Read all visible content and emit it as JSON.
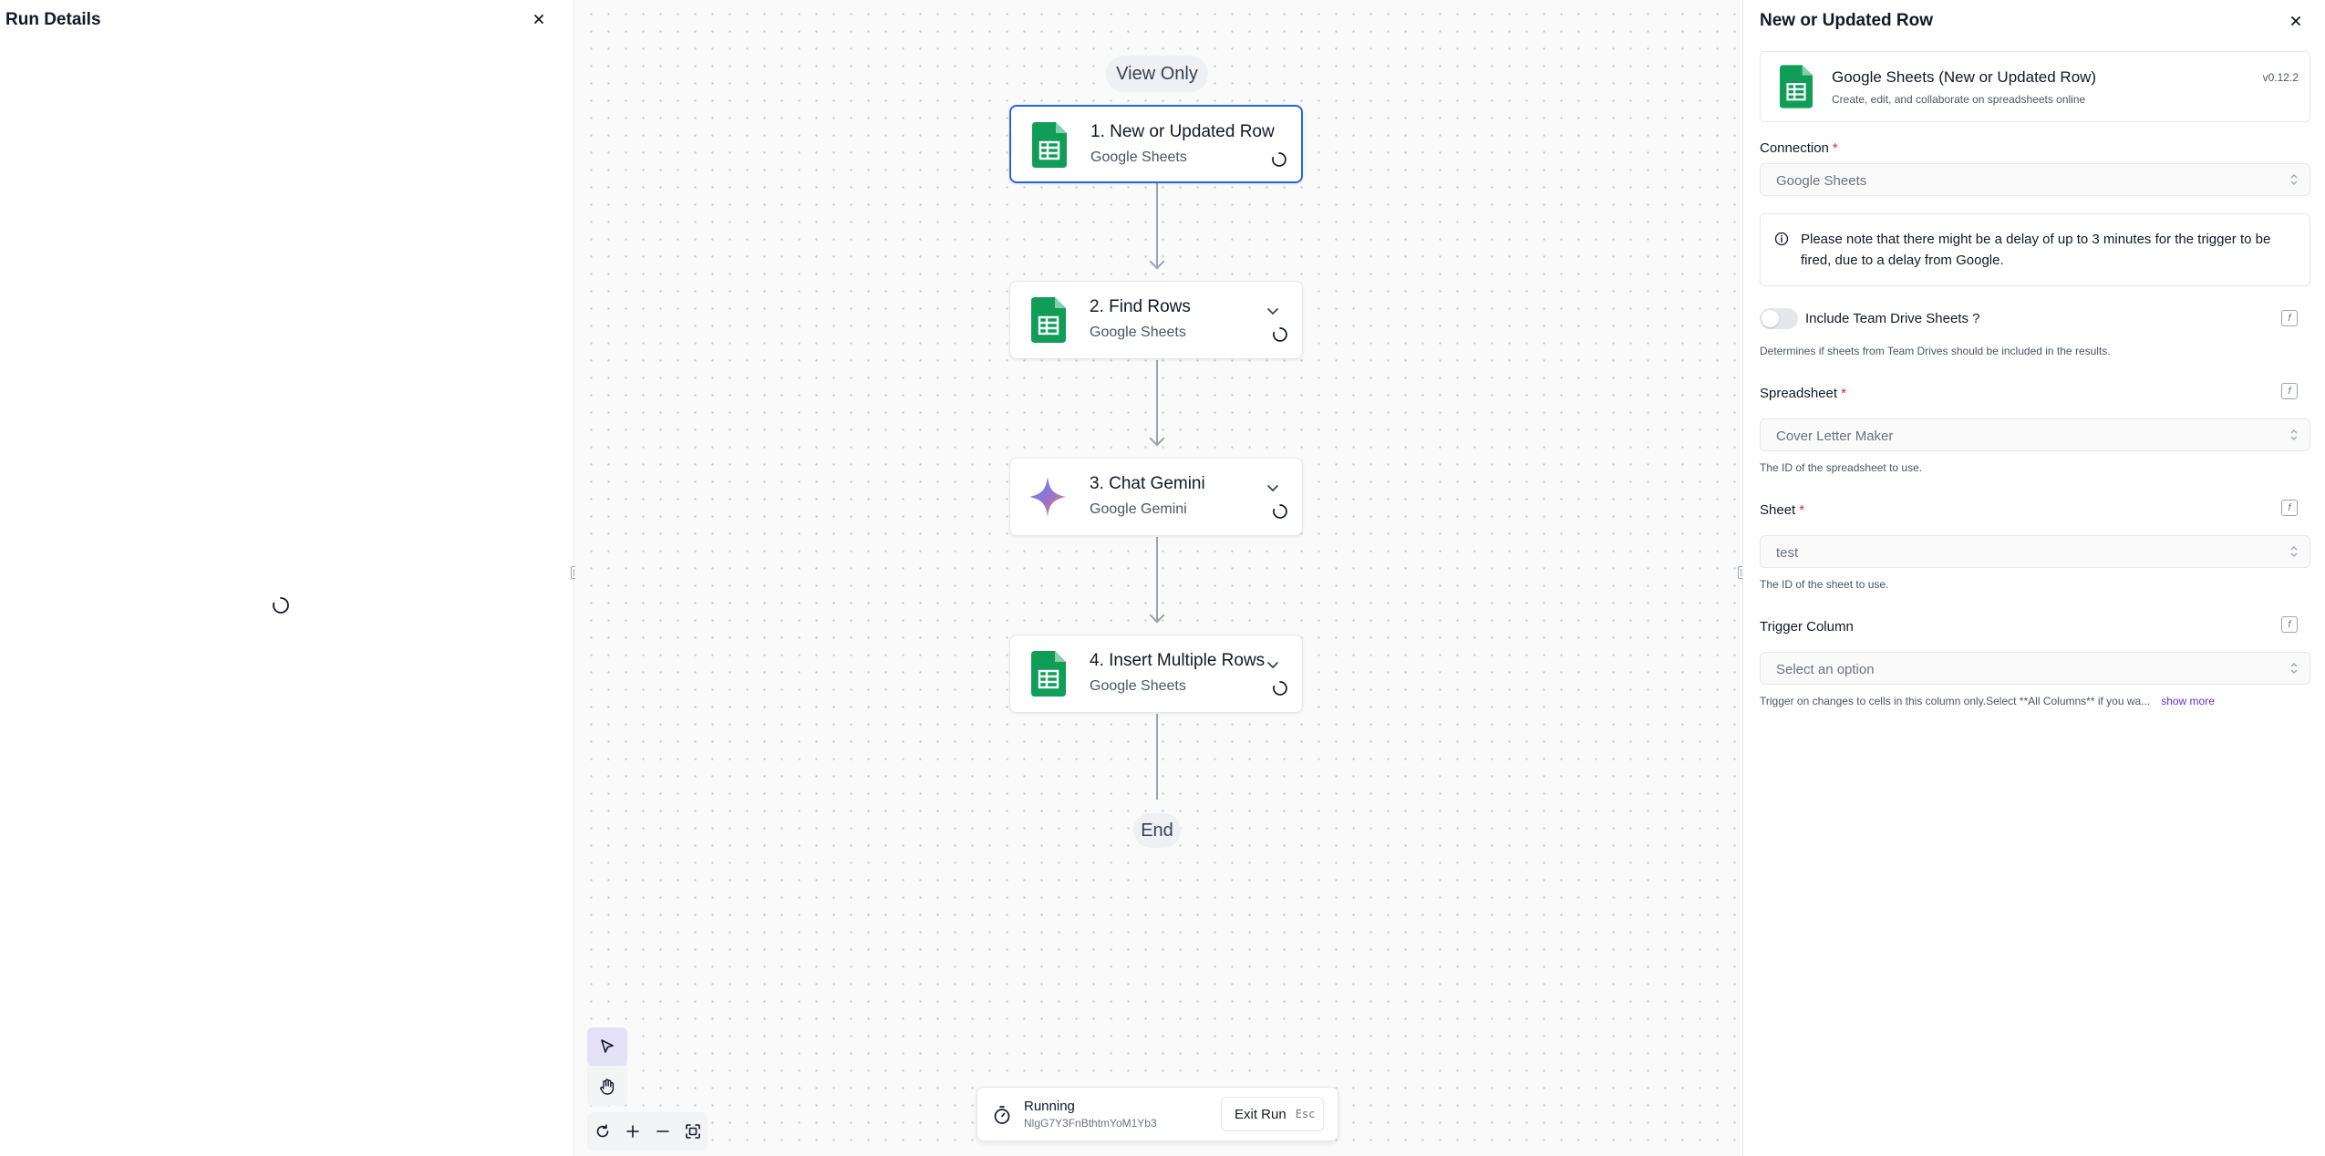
{
  "left_panel": {
    "title": "Run Details"
  },
  "canvas": {
    "view_only_label": "View Only",
    "end_label": "End",
    "steps": [
      {
        "title": "1. New or Updated Row",
        "subtitle": "Google Sheets",
        "icon": "google-sheets-icon"
      },
      {
        "title": "2. Find Rows",
        "subtitle": "Google Sheets",
        "icon": "google-sheets-icon"
      },
      {
        "title": "3. Chat Gemini",
        "subtitle": "Google Gemini",
        "icon": "gemini-icon"
      },
      {
        "title": "4. Insert Multiple Rows",
        "subtitle": "Google Sheets",
        "icon": "google-sheets-icon"
      }
    ],
    "run_bar": {
      "status": "Running",
      "run_id": "NlgG7Y3FnBthtmYoM1Yb3",
      "exit_label": "Exit Run",
      "exit_shortcut": "Esc"
    }
  },
  "right_panel": {
    "title": "New or Updated Row",
    "piece": {
      "name": "Google Sheets (New or Updated Row)",
      "description": "Create, edit, and collaborate on spreadsheets online",
      "version": "v0.12.2"
    },
    "connection": {
      "label": "Connection",
      "value": "Google Sheets"
    },
    "notice": "Please note that there might be a delay of up to 3 minutes for the trigger to be fired, due to a delay from Google.",
    "team_drive": {
      "label": "Include Team Drive Sheets ?",
      "help": "Determines if sheets from Team Drives should be included in the results.",
      "enabled": false
    },
    "spreadsheet": {
      "label": "Spreadsheet",
      "value": "Cover Letter Maker",
      "help": "The ID of the spreadsheet to use."
    },
    "sheet": {
      "label": "Sheet",
      "value": "test",
      "help": "The ID of the sheet to use."
    },
    "trigger_column": {
      "label": "Trigger Column",
      "placeholder": "Select an option",
      "help": "Trigger on changes to cells in this column only.Select **All Columns** if you wa...",
      "show_more": "show more"
    }
  },
  "colors": {
    "accent": "#2563eb",
    "sheets_green": "#0f9d58",
    "link_purple": "#6d28d9",
    "required_red": "#dc2626"
  }
}
